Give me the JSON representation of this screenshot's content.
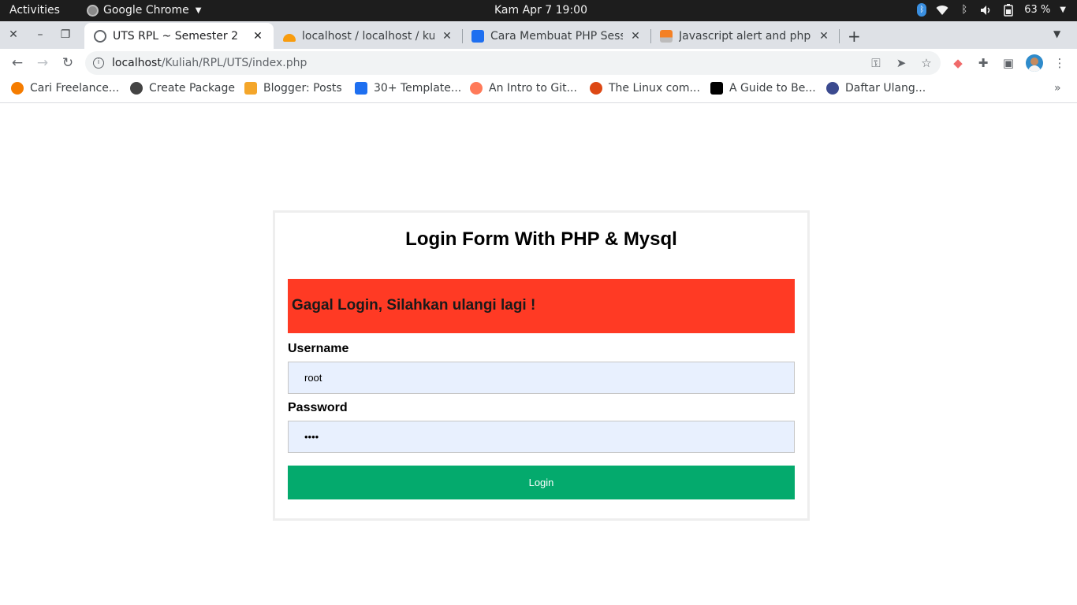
{
  "system_bar": {
    "activities": "Activities",
    "app_name": "Google Chrome",
    "clock": "Kam Apr 7  19:00",
    "battery": "63 %"
  },
  "tabs": [
    {
      "title": "UTS RPL ~ Semester 2",
      "active": true
    },
    {
      "title": "localhost / localhost / kuli",
      "active": false
    },
    {
      "title": "Cara Membuat PHP Sessio",
      "active": false
    },
    {
      "title": "Javascript alert and php h",
      "active": false
    }
  ],
  "address_bar": {
    "host": "localhost",
    "path": "/Kuliah/RPL/UTS/index.php"
  },
  "bookmarks": [
    {
      "label": "Cari Freelance...",
      "color": "#f57c00"
    },
    {
      "label": "Create Package",
      "color": "#444444"
    },
    {
      "label": "Blogger: Posts",
      "color": "#f4a62a"
    },
    {
      "label": "30+ Template...",
      "color": "#1e6ff0"
    },
    {
      "label": "An Intro to Git...",
      "color": "#ff7a59"
    },
    {
      "label": "The Linux com...",
      "color": "#dd4814"
    },
    {
      "label": "A Guide to Be...",
      "color": "#000000"
    },
    {
      "label": "Daftar Ulang...",
      "color": "#3b4a8f"
    }
  ],
  "bookmarks_more": "»",
  "login": {
    "title": "Login Form With PHP & Mysql",
    "error_message": "Gagal Login, Silahkan ulangi lagi !",
    "username_label": "Username",
    "username_value": "root",
    "password_label": "Password",
    "password_value": "••••",
    "submit_label": "Login"
  },
  "colors": {
    "alert_bg": "#ff3a24",
    "button_bg": "#04aa6d",
    "input_bg": "#e8f0fe"
  }
}
